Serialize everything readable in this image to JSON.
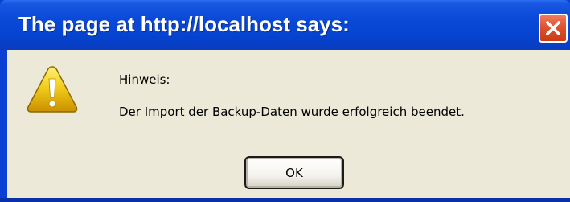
{
  "dialog": {
    "title": "The page at http://localhost says:",
    "message_line1": "Hinweis:",
    "message_line2": "Der Import der Backup-Daten wurde erfolgreich beendet.",
    "ok_label": "OK",
    "icon": "warning-icon",
    "close_icon": "close-icon"
  },
  "colors": {
    "titlebar": "#0a49d8",
    "client_bg": "#ece9d8",
    "close_button": "#e0532f",
    "warning_yellow": "#f0c400"
  }
}
